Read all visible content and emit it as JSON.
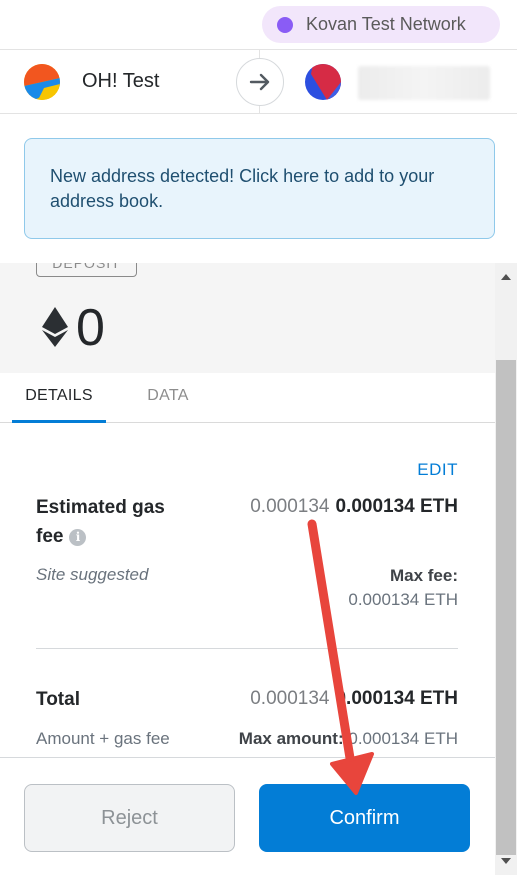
{
  "network": {
    "label": "Kovan Test Network",
    "dot_color": "#8a5cf5"
  },
  "accounts": {
    "from_name": "OH! Test",
    "from_icon": "jazzicon-avatar",
    "to_icon": "jazzicon-avatar",
    "arrow_icon": "arrow-right-icon"
  },
  "alert": {
    "text": "New address detected! Click here to add to your address book."
  },
  "summary": {
    "tag": "DEPOSIT",
    "amount": "0",
    "currency_icon": "eth-diamond-icon"
  },
  "tabs": [
    {
      "label": "DETAILS",
      "active": true
    },
    {
      "label": "DATA",
      "active": false
    }
  ],
  "details": {
    "edit_label": "EDIT",
    "gas": {
      "label_line1": "Estimated gas",
      "label_line2": "fee",
      "value_muted": "0.000134",
      "value_bold": "0.000134 ETH",
      "sub_label": "Site suggested",
      "max_fee_label": "Max fee:",
      "max_fee_value": "0.000134 ETH"
    },
    "total": {
      "label": "Total",
      "value_muted": "0.000134",
      "value_bold": "0.000134 ETH",
      "sub_label": "Amount + gas fee",
      "max_amount_label": "Max amount:",
      "max_amount_value": "0.000134 ETH"
    }
  },
  "footer": {
    "reject_label": "Reject",
    "confirm_label": "Confirm"
  },
  "colors": {
    "accent": "#037dd6",
    "annotation": "#e8453c"
  }
}
